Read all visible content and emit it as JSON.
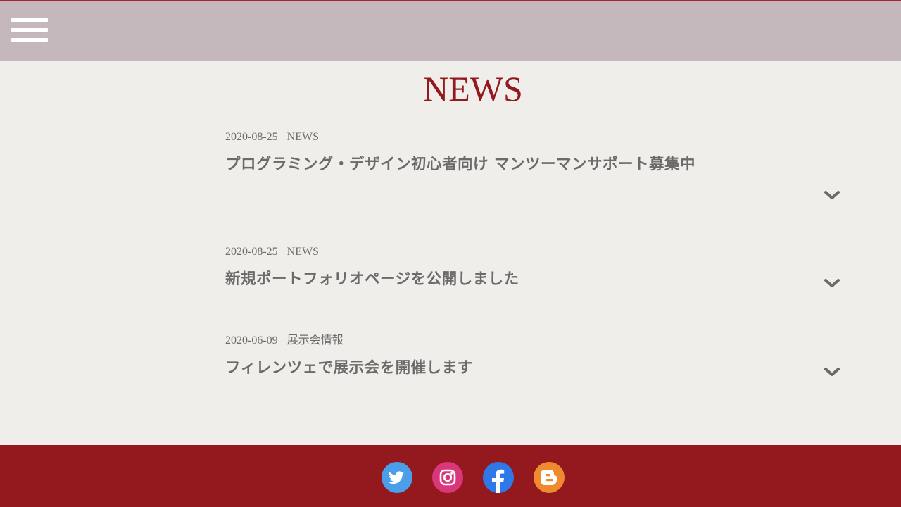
{
  "header": {
    "menu_icon": "hamburger-menu-icon"
  },
  "main": {
    "title": "NEWS",
    "items": [
      {
        "date": "2020-08-25",
        "category": "NEWS",
        "headline": "プログラミング・デザイン初心者向け マンツーマンサポート募集中"
      },
      {
        "date": "2020-08-25",
        "category": "NEWS",
        "headline": "新規ポートフォリオページを公開しました"
      },
      {
        "date": "2020-06-09",
        "category": "展示会情報",
        "headline": "フィレンツェで展示会を開催します"
      }
    ]
  },
  "footer": {
    "social": [
      "twitter-icon",
      "instagram-icon",
      "facebook-icon",
      "blogger-icon"
    ]
  },
  "colors": {
    "header_bg": "#c4b8bc",
    "accent": "#93191f",
    "page_bg": "#f0eeea",
    "text": "#6a6a6a"
  }
}
